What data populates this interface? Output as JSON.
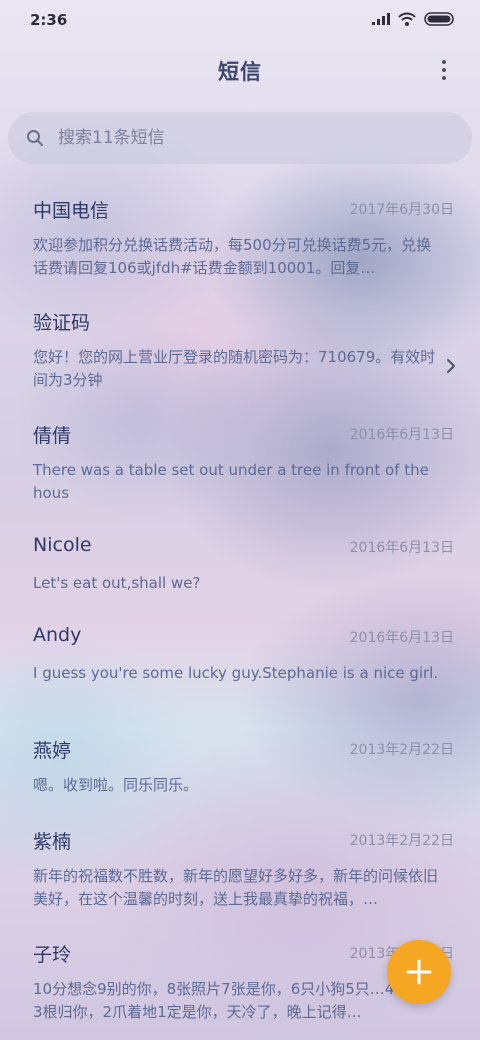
{
  "status_bar": {
    "time": "2:36"
  },
  "header": {
    "title": "短信"
  },
  "search": {
    "placeholder": "搜索11条短信"
  },
  "colors": {
    "fab": "#f5a623",
    "name": "#2f3a6a",
    "preview": "#5c6a96",
    "date": "#8d90a8"
  },
  "icons": [
    "signal-icon",
    "wifi-icon",
    "battery-icon",
    "more-icon",
    "search-icon",
    "chevron-right-icon",
    "add-icon"
  ],
  "messages": [
    {
      "name": "中国电信",
      "date": "2017年6月30日",
      "preview": "欢迎参加积分兑换话费活动，每500分可兑换话费5元，兑换话费请回复106或jfdh#话费金额到10001。回复…"
    },
    {
      "name": "验证码",
      "date": "",
      "preview": "您好！您的网上营业厅登录的随机密码为：710679。有效时间为3分钟"
    },
    {
      "name": "倩倩",
      "date": "2016年6月13日",
      "preview": "There was a table set out under a tree in front of the hous"
    },
    {
      "name": "Nicole",
      "date": "2016年6月13日",
      "preview": "Let's eat out,shall we?"
    },
    {
      "name": "Andy",
      "date": "2016年6月13日",
      "preview": "I guess you're some lucky guy.Stephanie is a nice girl."
    },
    {
      "name": "燕婷",
      "date": "2013年2月22日",
      "preview": "嗯。收到啦。同乐同乐。"
    },
    {
      "name": "紫楠",
      "date": "2013年2月22日",
      "preview": "新年的祝福数不胜数，新年的愿望好多好多，新年的问候依旧美好，在这个温馨的时刻，送上我最真挚的祝福，…"
    },
    {
      "name": "子玲",
      "date": "2013年2月22日",
      "preview": "10分想念9别的你，8张照片7张是你，6只小狗5只…4根骨头3根归你，2爪着地1定是你，天冷了，晚上记得…"
    }
  ]
}
